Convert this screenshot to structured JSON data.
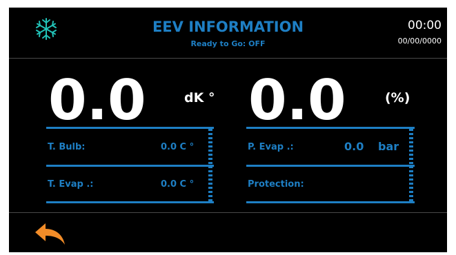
{
  "header": {
    "title": "EEV INFORMATION",
    "subtitle": "Ready to Go: OFF",
    "time": "00:00",
    "date": "00/00/0000",
    "icon": "snowflake-icon"
  },
  "readouts": {
    "left": {
      "value": "0.0",
      "unit": "dK °"
    },
    "right": {
      "value": "0.0",
      "unit": "(%)"
    }
  },
  "fields": {
    "t_bulb": {
      "label": "T. Bulb:",
      "value": "0.0 C °"
    },
    "t_evap": {
      "label": "T. Evap .:",
      "value": "0.0 C °"
    },
    "p_evap": {
      "label": "P. Evap .:",
      "value": "0.0",
      "unit": "bar"
    },
    "protection": {
      "label": "Protection:",
      "value": ""
    }
  },
  "footer": {
    "back_icon": "back-arrow-icon"
  },
  "colors": {
    "accent": "#1e7fc4",
    "background": "#000000",
    "text": "#ffffff",
    "back_arrow": "#f28c28"
  }
}
